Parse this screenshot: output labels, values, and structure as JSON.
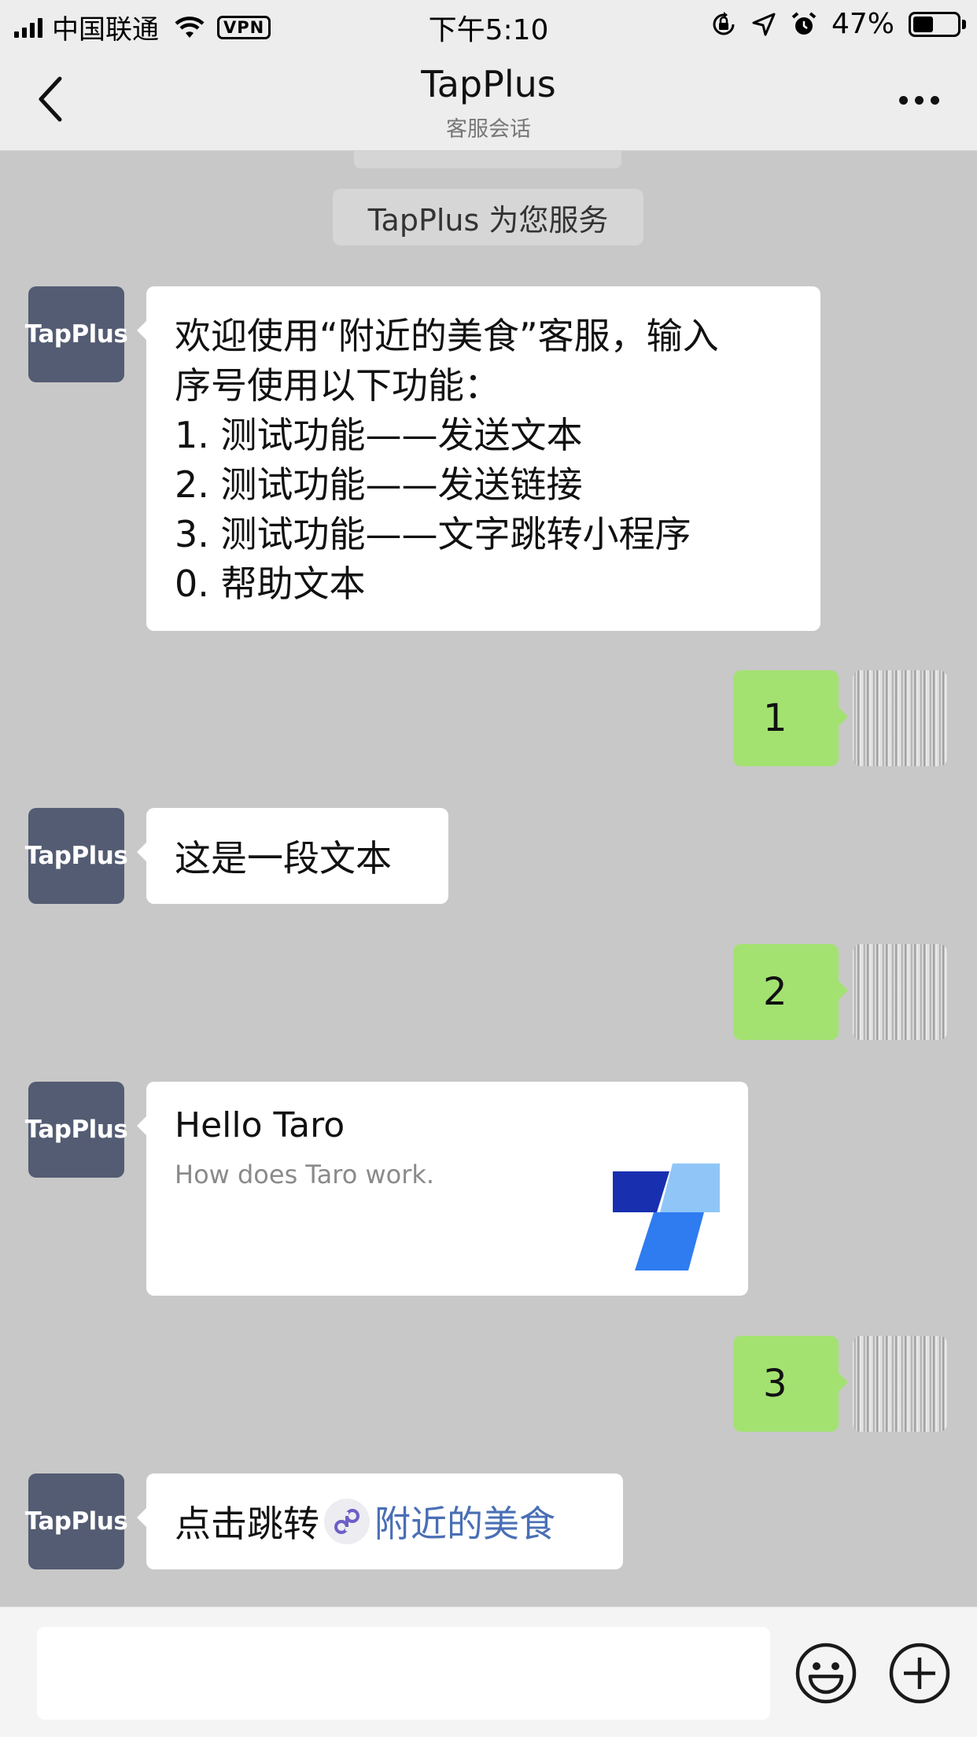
{
  "status_bar": {
    "carrier": "中国联通",
    "vpn": "VPN",
    "time": "下午5:10",
    "battery_percent": "47%",
    "battery_level": 0.47
  },
  "nav": {
    "title": "TapPlus",
    "subtitle": "客服会话"
  },
  "chat": {
    "system_notice": "TapPlus 为您服务",
    "bot_avatar_text": "TapPlus",
    "welcome_lines": [
      "欢迎使用“附近的美食”客服，输入",
      "序号使用以下功能：",
      "1. 测试功能——发送文本",
      "2. 测试功能——发送链接",
      "3. 测试功能——文字跳转小程序",
      "0. 帮助文本"
    ],
    "user_reply_1": "1",
    "bot_text_reply": "这是一段文本",
    "user_reply_2": "2",
    "link_card": {
      "title": "Hello Taro",
      "description": "How does Taro work."
    },
    "user_reply_3": "3",
    "jump_prefix": "点击跳转",
    "jump_link_text": "附近的美食"
  },
  "colors": {
    "chat_background": "#c8c8c8",
    "user_bubble": "#a3e271",
    "bot_bubble": "#ffffff",
    "bot_avatar": "#545c73",
    "mini_program_link": "#4a6fb5"
  },
  "input_bar": {
    "value": "",
    "emoji_icon": "emoji-icon",
    "add_icon": "plus-circle-icon"
  }
}
